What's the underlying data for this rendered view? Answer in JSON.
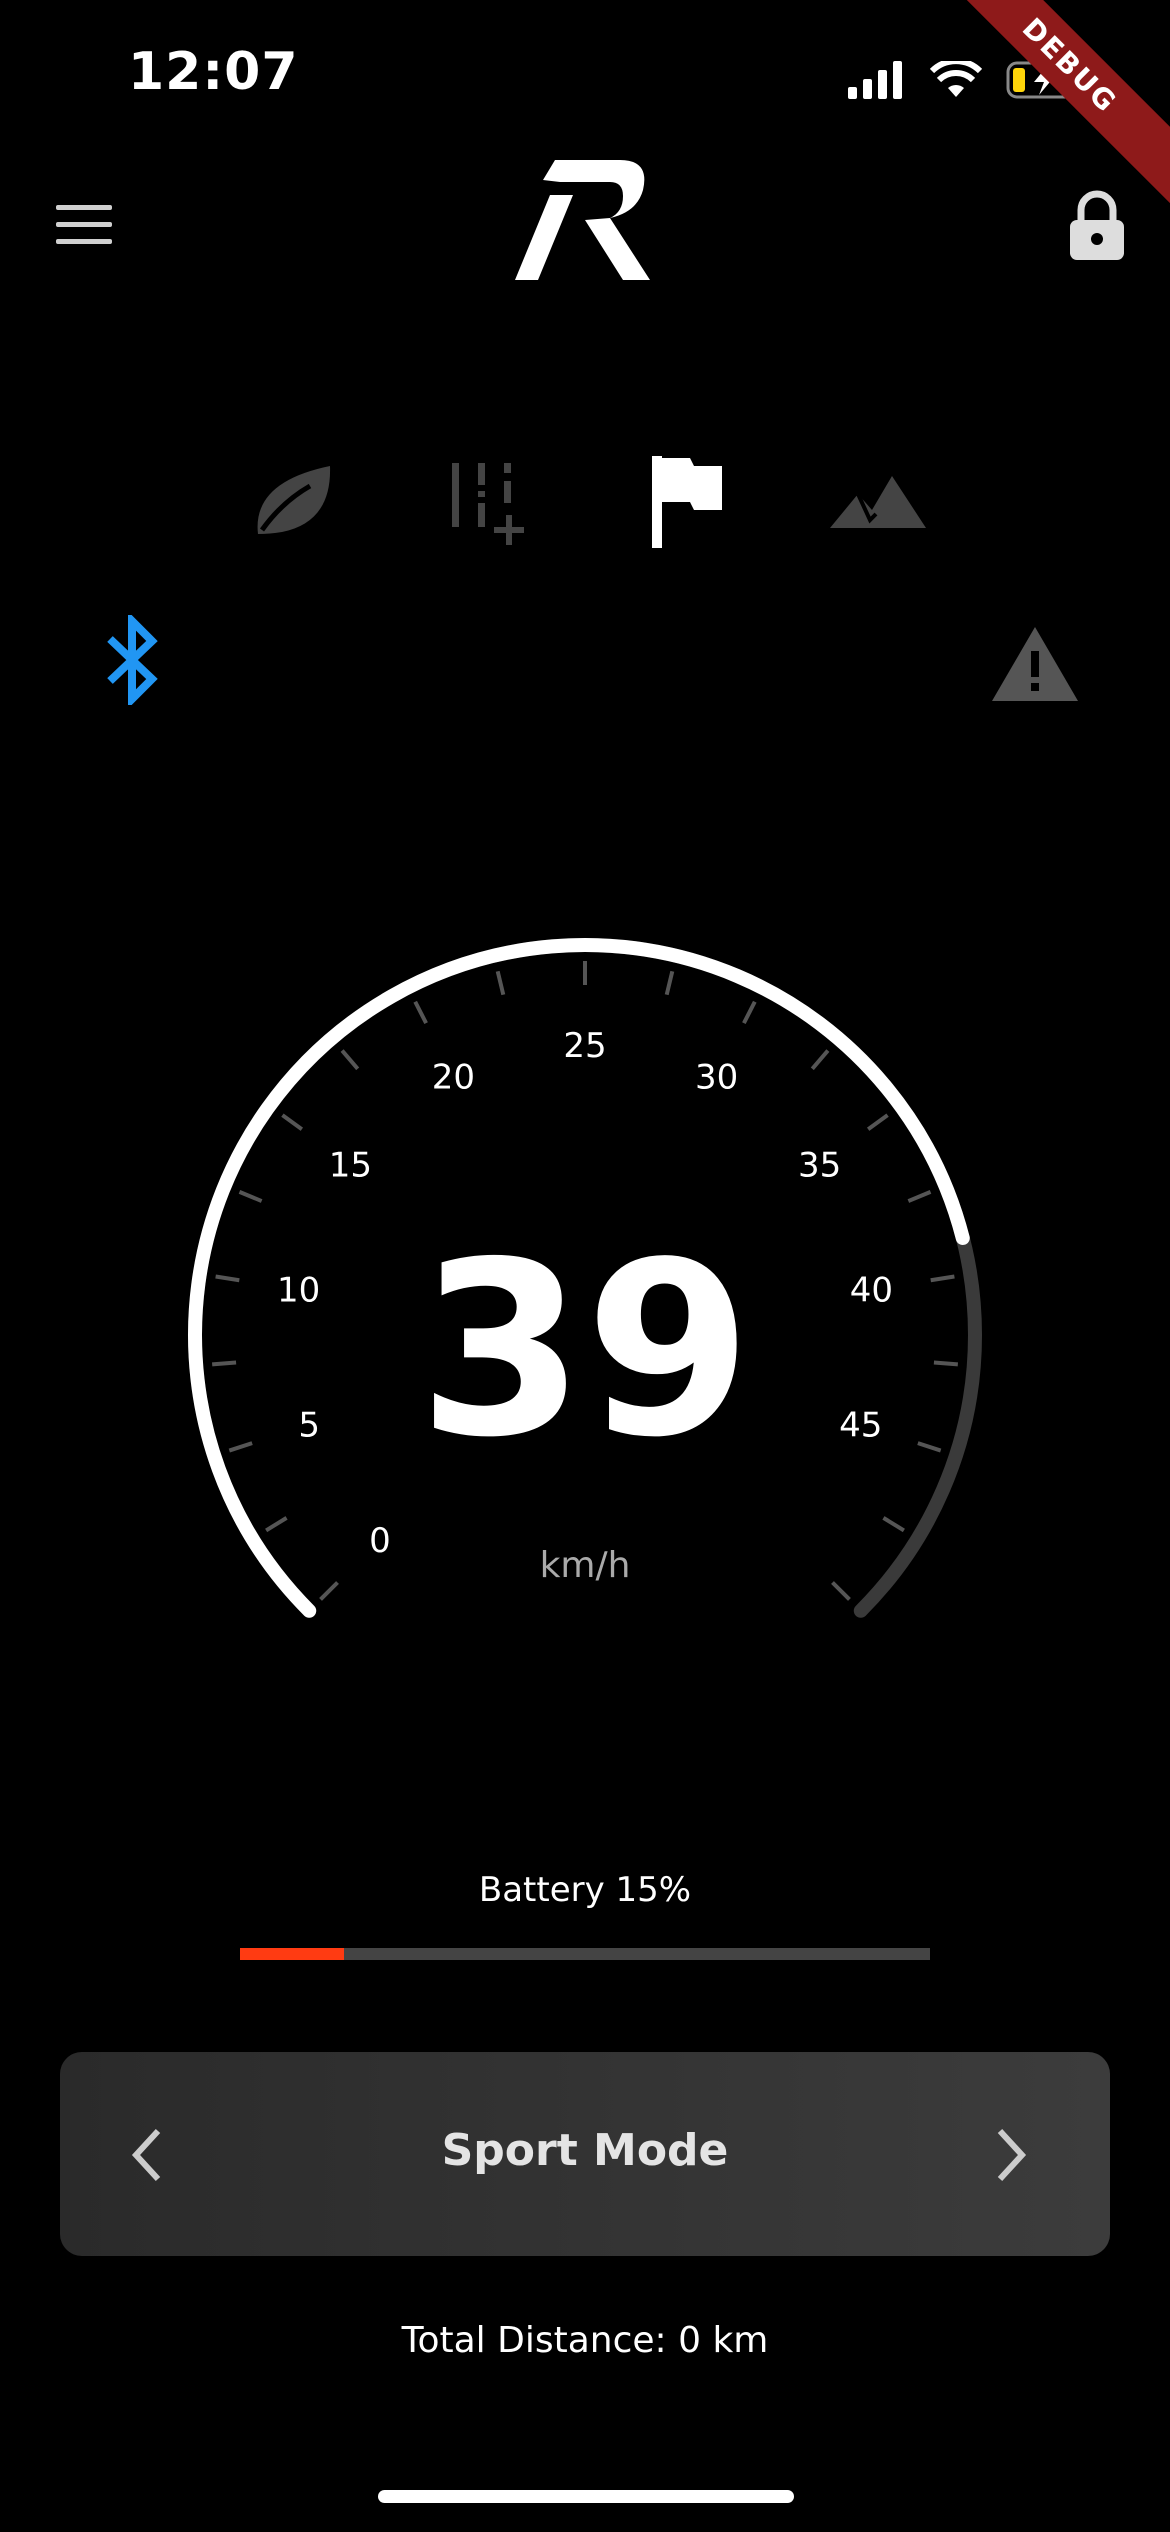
{
  "status_bar": {
    "time": "12:07",
    "icons": [
      "cellular-signal-icon",
      "wifi-icon",
      "battery-charging-icon"
    ]
  },
  "debug_banner": "DEBUG",
  "header": {
    "menu_icon": "hamburger-menu-icon",
    "logo": "R",
    "lock_icon": "lock-icon"
  },
  "ride_modes": [
    {
      "name": "eco",
      "icon": "leaf-icon",
      "active": false
    },
    {
      "name": "custom",
      "icon": "sliders-plus-icon",
      "active": false
    },
    {
      "name": "sport",
      "icon": "flag-icon",
      "active": true
    },
    {
      "name": "offroad",
      "icon": "mountain-icon",
      "active": false
    }
  ],
  "indicators": {
    "bluetooth": {
      "icon": "bluetooth-icon",
      "connected": true,
      "color": "#2196f3"
    },
    "warning": {
      "icon": "warning-icon"
    }
  },
  "speedometer": {
    "value": "39",
    "unit": "km/h",
    "max": 50,
    "current": 39,
    "tick_labels": [
      "0",
      "5",
      "10",
      "15",
      "20",
      "25",
      "30",
      "35",
      "40",
      "45"
    ]
  },
  "battery": {
    "label": "Battery 15%",
    "level": 0.15,
    "fill_color": "#ff3b12"
  },
  "mode_selector": {
    "label": "Sport Mode",
    "prev_icon": "chevron-left-icon",
    "next_icon": "chevron-right-icon"
  },
  "total_distance": "Total Distance: 0 km"
}
